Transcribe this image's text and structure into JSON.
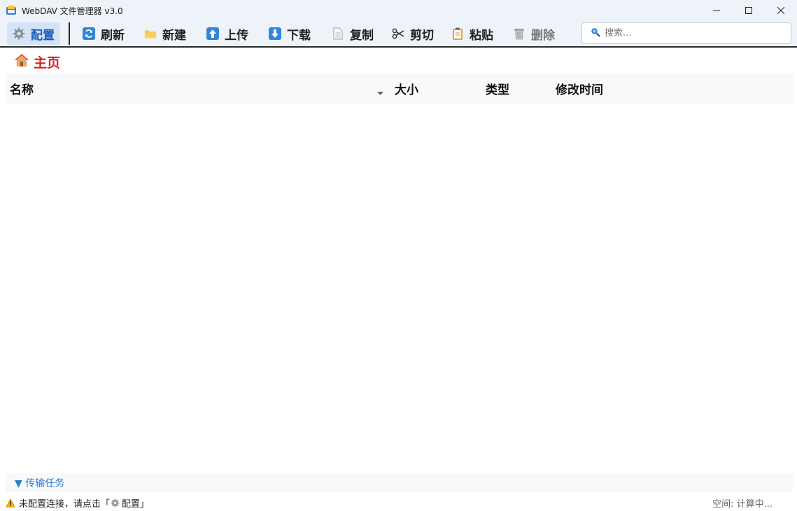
{
  "window": {
    "title": "WebDAV 文件管理器 v3.0",
    "controls": [
      "minimize",
      "maximize",
      "close"
    ]
  },
  "toolbar": {
    "config_label": "配置",
    "refresh_label": "刷新",
    "new_label": "新建",
    "upload_label": "上传",
    "download_label": "下载",
    "copy_label": "复制",
    "cut_label": "剪切",
    "paste_label": "粘贴",
    "delete_label": "删除",
    "search_placeholder": "搜索...",
    "search_value": ""
  },
  "breadcrumb": {
    "home_label": "主页",
    "home_color": "#e11c1c"
  },
  "table": {
    "columns": [
      "名称",
      "大小",
      "类型",
      "修改时间"
    ],
    "rows": []
  },
  "transfer": {
    "label": "▼ 传输任务",
    "color": "#2d7dd2"
  },
  "status": {
    "message_prefix": "未配置连接，请点击「",
    "message_config": "配置",
    "message_suffix": "」",
    "space_label": "空间: 计算中..."
  },
  "colors": {
    "accent": "#1f5fbf",
    "toolbar_bg": "#eef3f9",
    "active_bg": "#d4e3f7"
  }
}
